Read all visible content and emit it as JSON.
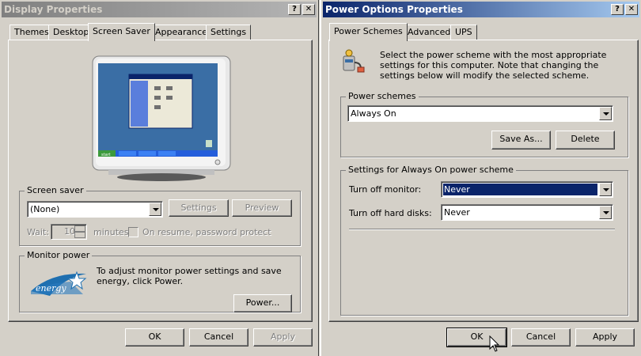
{
  "display_props": {
    "title": "Display Properties",
    "help_label": "?",
    "close_label": "✕",
    "tabs": [
      "Themes",
      "Desktop",
      "Screen Saver",
      "Appearance",
      "Settings"
    ],
    "selected_tab": "Screen Saver",
    "preview_taskbar": {
      "start_label": "start"
    },
    "screen_saver": {
      "legend": "Screen saver",
      "selected": "(None)",
      "settings_label": "Settings",
      "preview_label": "Preview",
      "wait_label": "Wait:",
      "wait_value": "10",
      "minutes_label": "minutes",
      "resume_label": "On resume, password protect"
    },
    "monitor_power": {
      "legend": "Monitor power",
      "description": "To adjust monitor power settings and save energy, click Power.",
      "power_label": "Power...",
      "logo_text": "energy"
    },
    "buttons": {
      "ok": "OK",
      "cancel": "Cancel",
      "apply": "Apply"
    }
  },
  "power_options": {
    "title": "Power Options Properties",
    "help_label": "?",
    "close_label": "✕",
    "tabs": [
      "Power Schemes",
      "Advanced",
      "UPS"
    ],
    "selected_tab": "Power Schemes",
    "intro": "Select the power scheme with the most appropriate settings for this computer. Note that changing the settings below will modify the selected scheme.",
    "schemes": {
      "legend": "Power schemes",
      "selected": "Always On",
      "save_as_label": "Save As...",
      "delete_label": "Delete"
    },
    "settings": {
      "legend": "Settings for Always On power scheme",
      "monitor_label": "Turn off monitor:",
      "monitor_value": "Never",
      "disks_label": "Turn off hard disks:",
      "disks_value": "Never"
    },
    "buttons": {
      "ok": "OK",
      "cancel": "Cancel",
      "apply": "Apply"
    }
  }
}
